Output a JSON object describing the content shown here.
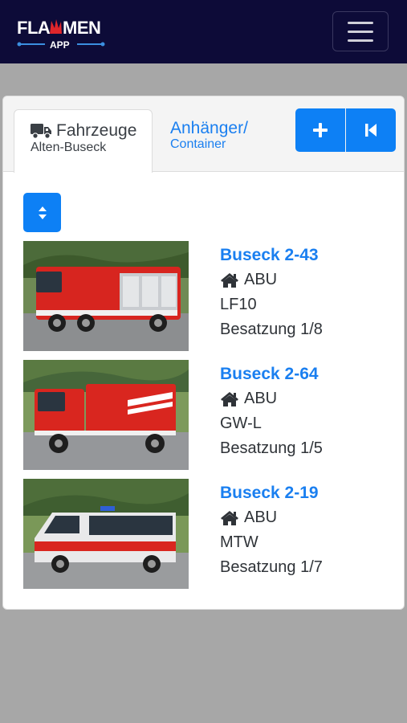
{
  "brand": {
    "logo_text": "FLAMMEN",
    "logo_sub": "APP"
  },
  "colors": {
    "navbar": "#0d0b38",
    "accent": "#0d80f5",
    "link": "#1a7ff0",
    "background": "#a7a7a7"
  },
  "tabs": [
    {
      "icon": "truck-icon",
      "label": "Fahrzeuge",
      "sublabel": "Alten-Buseck",
      "active": true
    },
    {
      "label": "Anhänger/",
      "sublabel": "Container",
      "active": false
    }
  ],
  "toolbar": {
    "add_icon": "plus-icon",
    "back_icon": "skip-back-icon",
    "sort_icon": "sort-icon"
  },
  "vehicles": [
    {
      "name": "Buseck 2-43",
      "location_icon": "home-icon",
      "location": "ABU",
      "type": "LF10",
      "crew": "Besatzung 1/8"
    },
    {
      "name": "Buseck 2-64",
      "location_icon": "home-icon",
      "location": "ABU",
      "type": "GW-L",
      "crew": "Besatzung 1/5"
    },
    {
      "name": "Buseck 2-19",
      "location_icon": "home-icon",
      "location": "ABU",
      "type": "MTW",
      "crew": "Besatzung 1/7"
    }
  ]
}
